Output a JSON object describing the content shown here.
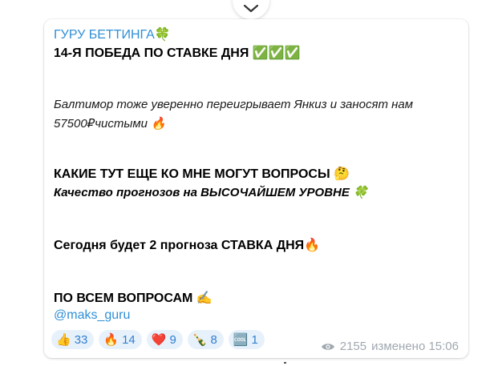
{
  "message": {
    "sender": "ГУРУ БЕТТИНГА🍀",
    "title": "14-Я ПОБЕДА ПО СТАВКЕ ДНЯ ✅✅✅",
    "text_line_1": "Балтимор тоже уверенно переигрывает Янкиз и заносят нам",
    "text_line_2": "57500₽чистыми 🔥",
    "question_line": "КАКИЕ ТУТ ЕЩЕ КО МНЕ МОГУТ ВОПРОСЫ 🤔",
    "quality_line": "Качество прогнозов на ВЫСОЧАЙШЕМ УРОВНЕ 🍀",
    "today_line": "Сегодня будет 2 прогноза СТАВКА ДНЯ🔥",
    "contact_line": "ПО ВСЕМ ВОПРОСАМ ✍️",
    "contact_handle": "@maks_guru"
  },
  "reactions": [
    {
      "emoji": "👍",
      "count": "33"
    },
    {
      "emoji": "🔥",
      "count": "14"
    },
    {
      "emoji": "❤️",
      "count": "9"
    },
    {
      "emoji": "🍾",
      "count": "8"
    },
    {
      "emoji": "🆒",
      "count": "1"
    }
  ],
  "meta": {
    "views": "2155",
    "edited_time": "изменено 15:06",
    "icon": "eye-icon"
  },
  "colors": {
    "link": "#2f8fd6",
    "reaction_bg": "#e7f1fb",
    "meta_text": "#a0a8b0"
  }
}
